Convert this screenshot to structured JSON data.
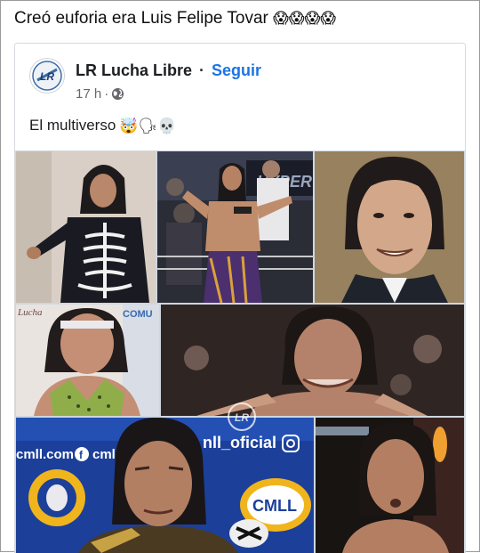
{
  "caption": {
    "text": "Creó euforia era Luis Felipe Tovar",
    "emojis": "😱😱😱😱"
  },
  "post": {
    "page_name": "LR Lucha Libre",
    "separator": "·",
    "follow_label": "Seguir",
    "time": "17 h",
    "time_separator": "·",
    "privacy_icon": "globe-icon",
    "avatar_logo_text": "LR",
    "text": "El multiverso",
    "text_emojis": "🤯🗣💀"
  },
  "images": {
    "tile_sign_labels": {
      "cmll_handle": "cmll.com",
      "cmll_social": "cmll_",
      "nll_oficial": "nll_oficial",
      "cmll_badge": "CMLL",
      "comu": "COMU",
      "lucha": "Lucha",
      "hyper": "HYPER"
    },
    "watermark": "LR"
  },
  "colors": {
    "link": "#1b74e4",
    "meta": "#65676b",
    "grid_gap": "#cfd7df"
  }
}
